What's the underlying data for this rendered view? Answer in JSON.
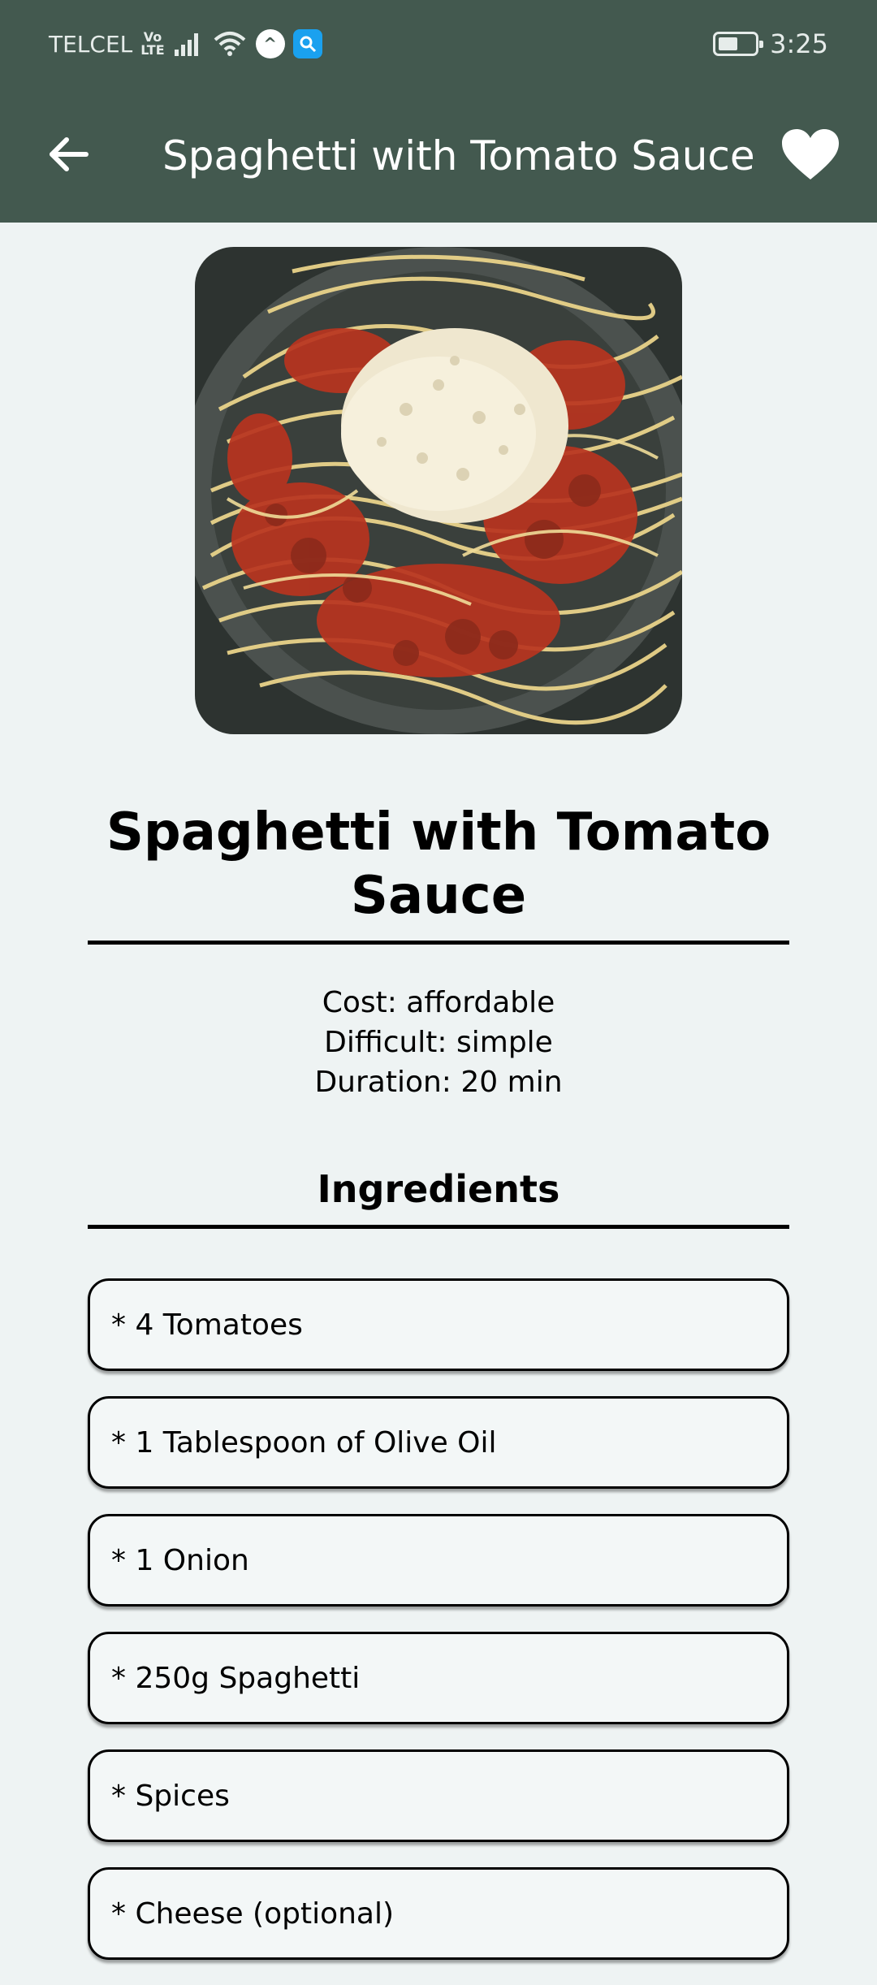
{
  "status_bar": {
    "carrier": "TELCEL",
    "volte": "Vo",
    "volte_sub": "LTE",
    "badge_letter": "^",
    "time": "3:25",
    "battery_level": 0.55
  },
  "app_bar": {
    "title": "Spaghetti with Tomato Sauce",
    "background_color": "#43594f",
    "back_icon": "arrow-left-icon",
    "favorite_icon": "heart-icon"
  },
  "recipe": {
    "title": "Spaghetti with Tomato Sauce",
    "cost": "Cost: affordable",
    "difficulty": "Difficult: simple",
    "duration": "Duration: 20 min"
  },
  "ingredients": {
    "heading": "Ingredients",
    "items": [
      "* 4 Tomatoes",
      "* 1 Tablespoon of Olive Oil",
      "* 1 Onion",
      "* 250g Spaghetti",
      "* Spices",
      "* Cheese (optional)"
    ]
  }
}
